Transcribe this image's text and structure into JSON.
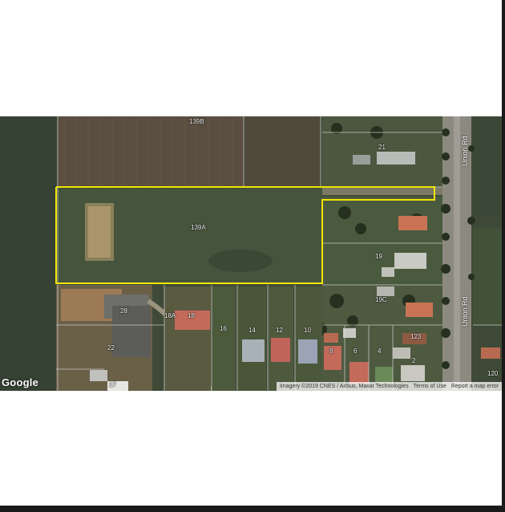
{
  "map": {
    "logo": "Google",
    "attribution": {
      "imagery": "Imagery ©2019 CNES / Airbus, Maxar Technologies",
      "terms": "Terms of Use",
      "report": "Report a map error"
    },
    "roads": [
      "Union Rd",
      "Union Rd"
    ],
    "parcel_labels": {
      "top": "139B",
      "main": "139A",
      "l21": "21",
      "l19": "19",
      "l19c": "19C",
      "l28": "28",
      "l18a": "18A",
      "l18": "18",
      "l16": "16",
      "l14": "14",
      "l12": "12",
      "l10": "10",
      "l22": "22",
      "l8": "8",
      "l6": "6",
      "l4": "4",
      "l123": "123",
      "l2": "2",
      "l17": "17",
      "l120": "120"
    },
    "highlight_color": "#f2e600"
  }
}
